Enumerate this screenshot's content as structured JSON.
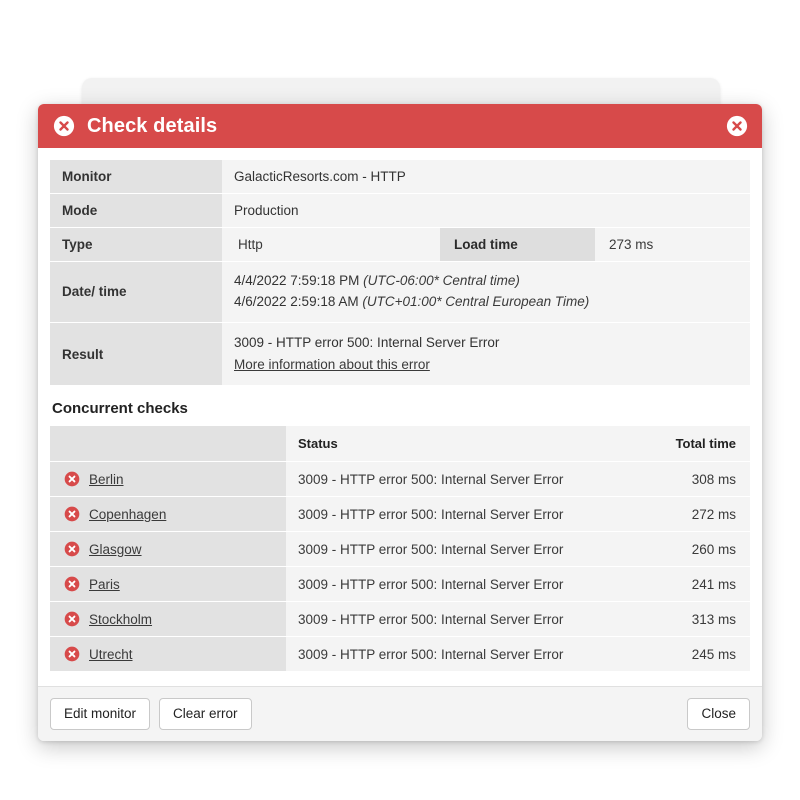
{
  "dialog": {
    "title": "Check details",
    "title_icon": "error-circle-x-icon",
    "close_icon": "close-circle-x-icon",
    "accent_color": "#d74a4a"
  },
  "details": {
    "monitor_label": "Monitor",
    "monitor_value": "GalacticResorts.com - HTTP",
    "mode_label": "Mode",
    "mode_value": "Production",
    "type_label": "Type",
    "type_value": "Http",
    "load_time_label": "Load time",
    "load_time_value": "273 ms",
    "datetime_label": "Date/ time",
    "datetime_line1_time": "4/4/2022 7:59:18 PM",
    "datetime_line1_tz": "(UTC-06:00* Central time)",
    "datetime_line2_time": "4/6/2022 2:59:18 AM",
    "datetime_line2_tz": "(UTC+01:00* Central European Time)",
    "result_label": "Result",
    "result_value": "3009 - HTTP error 500: Internal Server Error",
    "result_link": "More information about this error"
  },
  "concurrent": {
    "section_title": "Concurrent checks",
    "columns": {
      "name": "",
      "status": "Status",
      "total_time": "Total time"
    },
    "rows": [
      {
        "city": "Berlin",
        "status": "3009 - HTTP error 500: Internal Server Error",
        "total_time": "308 ms",
        "icon": "error-circle-x-icon"
      },
      {
        "city": "Copenhagen",
        "status": "3009 - HTTP error 500: Internal Server Error",
        "total_time": "272 ms",
        "icon": "error-circle-x-icon"
      },
      {
        "city": "Glasgow",
        "status": "3009 - HTTP error 500: Internal Server Error",
        "total_time": "260 ms",
        "icon": "error-circle-x-icon"
      },
      {
        "city": "Paris",
        "status": "3009 - HTTP error 500: Internal Server Error",
        "total_time": "241 ms",
        "icon": "error-circle-x-icon"
      },
      {
        "city": "Stockholm",
        "status": "3009 - HTTP error 500: Internal Server Error",
        "total_time": "313 ms",
        "icon": "error-circle-x-icon"
      },
      {
        "city": "Utrecht",
        "status": "3009 - HTTP error 500: Internal Server Error",
        "total_time": "245 ms",
        "icon": "error-circle-x-icon"
      }
    ]
  },
  "footer": {
    "edit_monitor": "Edit monitor",
    "clear_error": "Clear error",
    "close": "Close"
  }
}
